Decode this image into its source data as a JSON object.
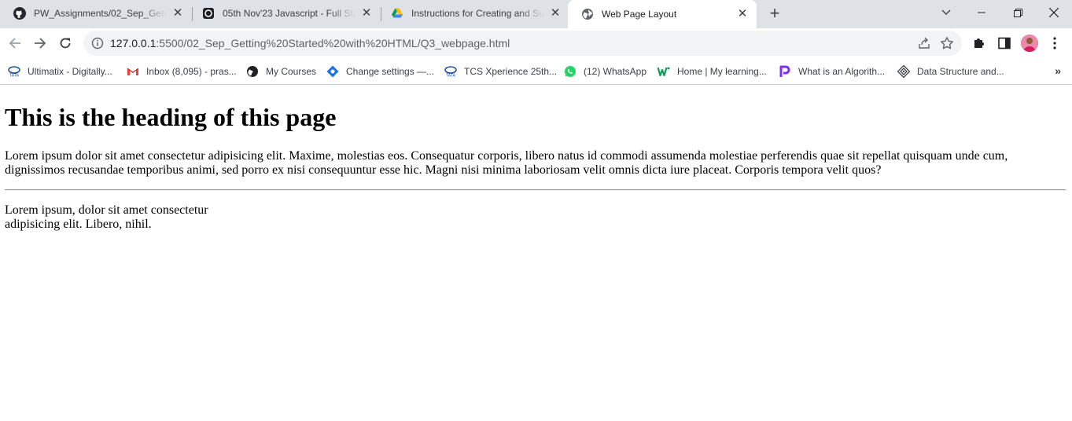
{
  "browser": {
    "tabs": [
      {
        "title": "PW_Assignments/02_Sep_Getting",
        "icon": "github-icon",
        "active": false
      },
      {
        "title": "05th Nov'23 Javascript - Full Sta",
        "icon": "page-icon",
        "active": false
      },
      {
        "title": "Instructions for Creating and Sub",
        "icon": "google-drive-icon",
        "active": false
      },
      {
        "title": "Web Page Layout",
        "icon": "globe-icon",
        "active": true
      }
    ],
    "url": {
      "host": "127.0.0.1",
      "rest": ":5500/02_Sep_Getting%20Started%20with%20HTML/Q3_webpage.html"
    },
    "bookmarks": [
      {
        "label": "Ultimatix - Digitally...",
        "icon": "tata-icon"
      },
      {
        "label": "Inbox (8,095) - pras...",
        "icon": "gmail-icon"
      },
      {
        "label": "My Courses",
        "icon": "globe-icon"
      },
      {
        "label": "Change settings —...",
        "icon": "settings-diamond-icon"
      },
      {
        "label": "TCS Xperience 25th...",
        "icon": "tata-icon"
      },
      {
        "label": "(12) WhatsApp",
        "icon": "whatsapp-icon"
      },
      {
        "label": "Home | My learning...",
        "icon": "w-logo-icon"
      },
      {
        "label": "What is an Algorith...",
        "icon": "p-logo-icon"
      },
      {
        "label": "Data Structure and...",
        "icon": "ds-logo-icon"
      }
    ],
    "colors": {
      "tabstrip": "#dee1e6",
      "omnibox": "#f1f3f4"
    }
  },
  "page": {
    "heading": "This is the heading of this page",
    "paragraph1": "Lorem ipsum dolor sit amet consectetur adipisicing elit. Maxime, molestias eos. Consequatur corporis, libero natus id commodi assumenda molestiae perferendis quae sit repellat quisquam unde cum, dignissimos recusandae temporibus animi, sed porro ex nisi consequuntur esse hic. Magni nisi minima laboriosam velit omnis dicta iure placeat. Corporis tempora velit quos?",
    "paragraph2": "Lorem ipsum, dolor sit amet consectetur adipisicing elit. Libero, nihil."
  }
}
